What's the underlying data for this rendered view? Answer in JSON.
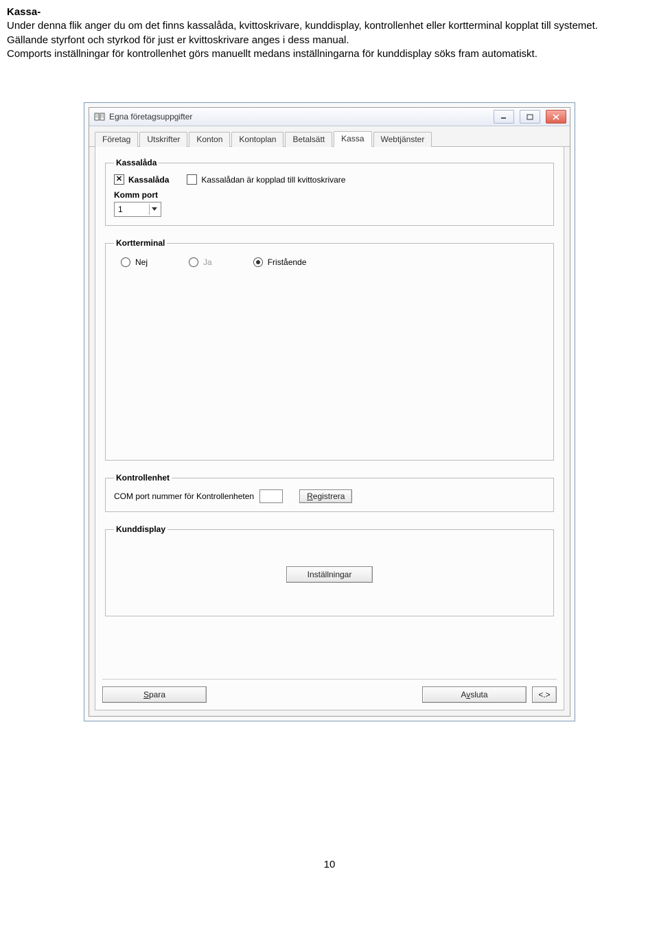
{
  "intro": {
    "heading": "Kassa-",
    "line1": "Under denna flik anger du om det finns kassalåda, kvittoskrivare, kunddisplay, kontrollenhet eller kortterminal kopplat till systemet.",
    "line2": "Gällande styrfont och styrkod för just er kvittoskrivare anges i dess manual.",
    "line3": "Comports inställningar för kontrollenhet görs manuellt medans inställningarna för kunddisplay söks fram automatiskt."
  },
  "window": {
    "title": "Egna företagsuppgifter"
  },
  "tabs": [
    "Företag",
    "Utskrifter",
    "Konton",
    "Kontoplan",
    "Betalsätt",
    "Kassa",
    "Webtjänster"
  ],
  "active_tab": "Kassa",
  "kassalada": {
    "legend": "Kassalåda",
    "cb1_label": "Kassalåda",
    "cb1_checked": true,
    "cb2_label": "Kassalådan är kopplad till kvittoskrivare",
    "cb2_checked": false,
    "komm_port_label": "Komm port",
    "komm_port_value": "1"
  },
  "kortterminal": {
    "legend": "Kortterminal",
    "options": {
      "nej": "Nej",
      "ja": "Ja",
      "fristaende": "Fristående"
    },
    "selected": "fristaende"
  },
  "kontrollenhet": {
    "legend": "Kontrollenhet",
    "label": "COM port nummer för Kontrollenheten",
    "value": "",
    "register_btn": "Registrera"
  },
  "kunddisplay": {
    "legend": "Kunddisplay",
    "btn": "Inställningar"
  },
  "buttons": {
    "save": "Spara",
    "close": "Avsluta",
    "nav": "<.>"
  },
  "page_number": "10"
}
